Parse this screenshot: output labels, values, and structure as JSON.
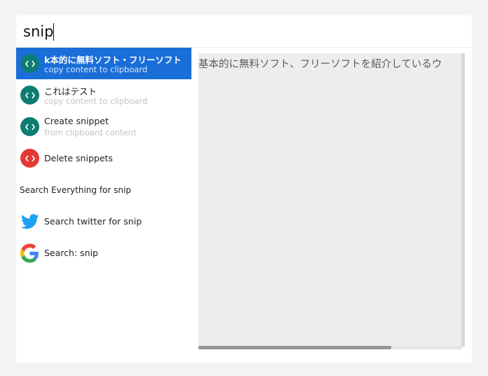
{
  "search": {
    "query": "snip",
    "placeholder": ""
  },
  "results": [
    {
      "title": "k本的に無料ソフト・フリーソフト",
      "subtitle": "copy content to clipboard",
      "icon": "code-icon",
      "icon_color": "#0d7d73",
      "selected": true
    },
    {
      "title": "これはテスト",
      "subtitle": "copy content to clipboard",
      "icon": "code-icon",
      "icon_color": "#0d7d73",
      "selected": false
    },
    {
      "title": "Create snippet",
      "subtitle": "from clipboard content",
      "icon": "code-icon",
      "icon_color": "#0d7d73",
      "selected": false
    },
    {
      "title": "Delete snippets",
      "subtitle": "",
      "icon": "code-icon",
      "icon_color": "#e53935",
      "selected": false
    }
  ],
  "section_label": "Search Everything for snip",
  "web_results": [
    {
      "title": "Search twitter for snip",
      "icon": "twitter-icon",
      "icon_color": "#1da1f2"
    },
    {
      "title": "Search: snip",
      "icon": "google-icon",
      "icon_color": "#4285f4"
    }
  ],
  "preview": {
    "text": "基本的に無料ソフト、フリーソフトを紹介しているウ"
  },
  "colors": {
    "selection": "#1a6ed8",
    "background": "#f3f3f3"
  }
}
